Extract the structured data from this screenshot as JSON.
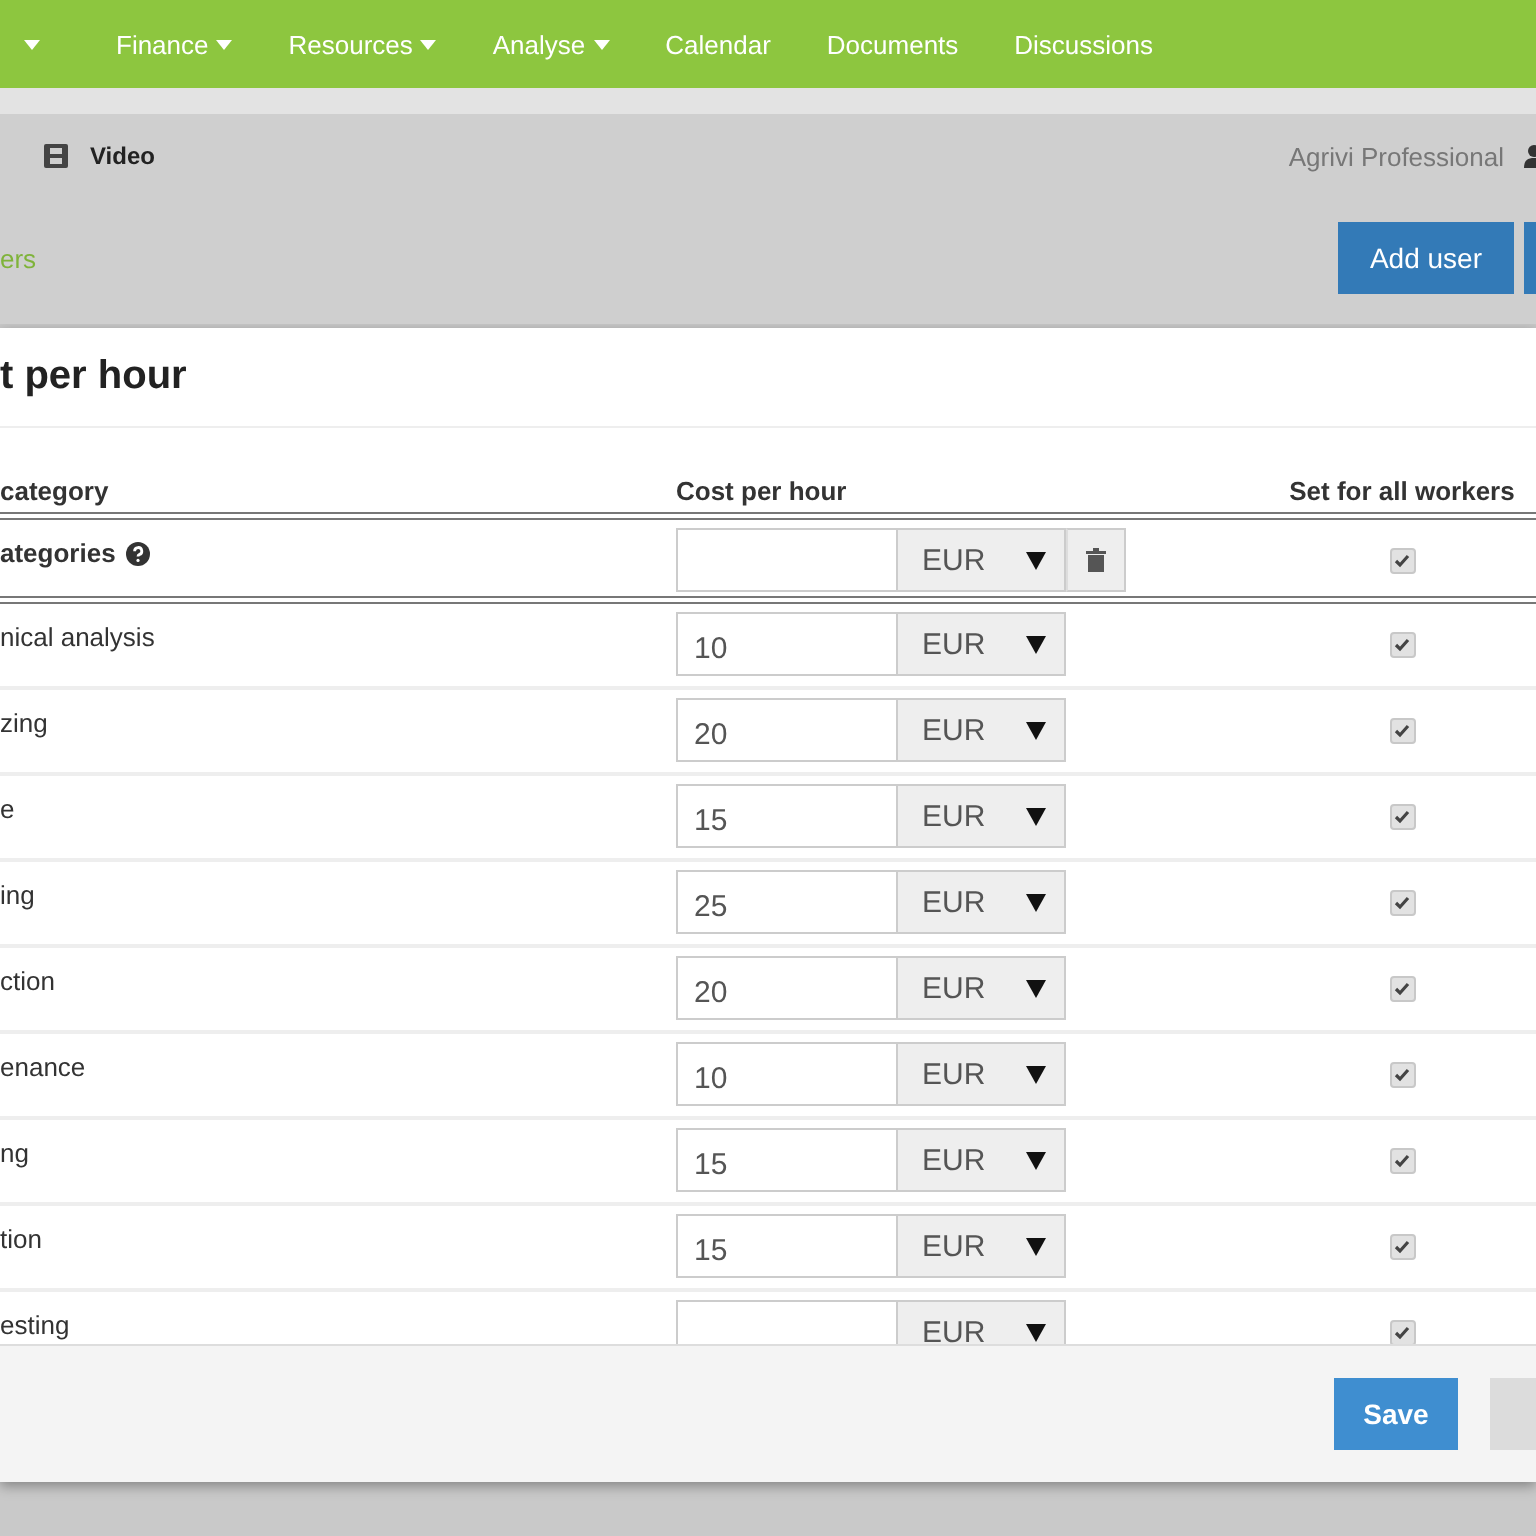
{
  "nav": {
    "items": [
      {
        "label": "Finance",
        "dropdown": true
      },
      {
        "label": "Resources",
        "dropdown": true
      },
      {
        "label": "Analyse",
        "dropdown": true
      },
      {
        "label": "Calendar",
        "dropdown": false
      },
      {
        "label": "Documents",
        "dropdown": false
      },
      {
        "label": "Discussions",
        "dropdown": false
      }
    ]
  },
  "toolbar": {
    "video_link": "Video",
    "account": "Agrivi Professional"
  },
  "breadcrumb": "ers",
  "add_user_button": "Add user",
  "modal": {
    "title": "t per hour",
    "columns": [
      "category",
      "Cost per hour",
      "Set for all workers"
    ],
    "all_row": {
      "label": "ategories",
      "currency": "EUR",
      "checked": true
    },
    "rows": [
      {
        "label": "nical analysis",
        "value": "10",
        "currency": "EUR",
        "checked": true
      },
      {
        "label": "zing",
        "value": "20",
        "currency": "EUR",
        "checked": true
      },
      {
        "label": "e",
        "value": "15",
        "currency": "EUR",
        "checked": true
      },
      {
        "label": "ing",
        "value": "25",
        "currency": "EUR",
        "checked": true
      },
      {
        "label": "ction",
        "value": "20",
        "currency": "EUR",
        "checked": true
      },
      {
        "label": "enance",
        "value": "10",
        "currency": "EUR",
        "checked": true
      },
      {
        "label": "ng",
        "value": "15",
        "currency": "EUR",
        "checked": true
      },
      {
        "label": "tion",
        "value": "15",
        "currency": "EUR",
        "checked": true
      },
      {
        "label": "esting",
        "currency": "EUR",
        "checked": true
      }
    ],
    "save_button": "Save"
  }
}
